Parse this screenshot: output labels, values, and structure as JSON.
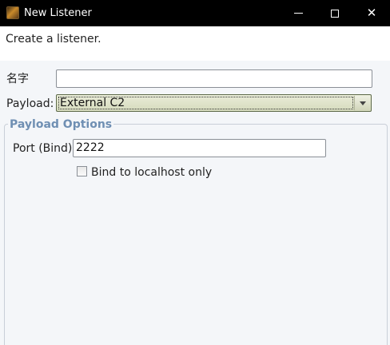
{
  "window": {
    "title": "New Listener",
    "minimize_glyph": "",
    "close_glyph": "✕"
  },
  "dialog": {
    "description": "Create a listener."
  },
  "form": {
    "name_label": "名字",
    "name_value": "",
    "payload_label": "Payload:",
    "payload_selected": "External C2"
  },
  "payload_options": {
    "title": "Payload Options",
    "port_label": "Port (Bind):",
    "port_value": "2222",
    "bind_localhost_label": "Bind to localhost only",
    "bind_localhost_checked": false
  }
}
